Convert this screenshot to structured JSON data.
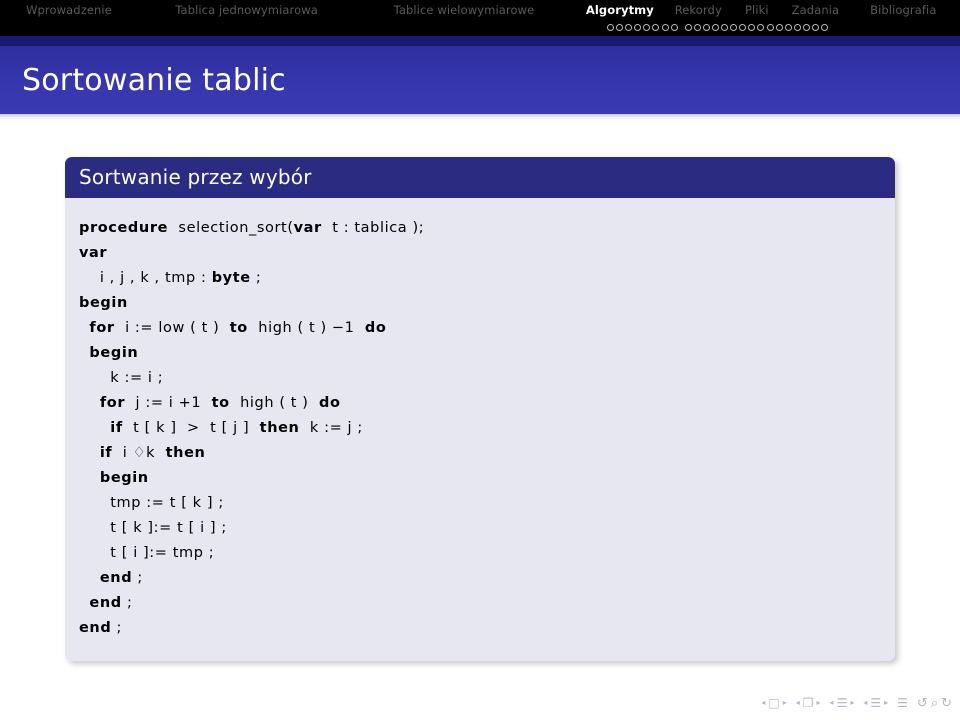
{
  "navbar": {
    "sections": [
      {
        "label": "Wprowadzenie",
        "active": false
      },
      {
        "label": "Tablica jednowymiarowa",
        "active": false
      },
      {
        "label": "Tablice wielowymiarowe",
        "active": false
      },
      {
        "label": "Algorytmy",
        "active": true
      },
      {
        "label": "Rekordy",
        "active": false
      },
      {
        "label": "Pliki",
        "active": false
      },
      {
        "label": "Zadania",
        "active": false
      },
      {
        "label": "Bibliografia",
        "active": false
      }
    ],
    "slide_dots": {
      "group_1_count": 8,
      "group_2_count": 16,
      "filled": 0
    }
  },
  "header": {
    "title": "Sortowanie tablic"
  },
  "block": {
    "title": "Sortwanie przez wybór",
    "code_lines": [
      [
        {
          "t": "procedure",
          "kw": true
        },
        {
          "t": "  selection_sort(",
          "kw": false
        },
        {
          "t": "var",
          "kw": true
        },
        {
          "t": "  t : tablica );",
          "kw": false
        }
      ],
      [
        {
          "t": "var",
          "kw": true
        }
      ],
      [
        {
          "t": "    i , j , k , tmp : ",
          "kw": false
        },
        {
          "t": "byte",
          "kw": true
        },
        {
          "t": " ;",
          "kw": false
        }
      ],
      [
        {
          "t": "begin",
          "kw": true
        }
      ],
      [
        {
          "t": "  ",
          "kw": false
        },
        {
          "t": "for",
          "kw": true
        },
        {
          "t": "  i := low ( t )  ",
          "kw": false
        },
        {
          "t": "to",
          "kw": true
        },
        {
          "t": "  high ( t ) −1  ",
          "kw": false
        },
        {
          "t": "do",
          "kw": true
        }
      ],
      [
        {
          "t": "  ",
          "kw": false
        },
        {
          "t": "begin",
          "kw": true
        }
      ],
      [
        {
          "t": "      k := i ;",
          "kw": false
        }
      ],
      [
        {
          "t": "    ",
          "kw": false
        },
        {
          "t": "for",
          "kw": true
        },
        {
          "t": "  j := i +1  ",
          "kw": false
        },
        {
          "t": "to",
          "kw": true
        },
        {
          "t": "  high ( t )  ",
          "kw": false
        },
        {
          "t": "do",
          "kw": true
        }
      ],
      [
        {
          "t": "      ",
          "kw": false
        },
        {
          "t": "if",
          "kw": true
        },
        {
          "t": "  t [ k ]  >  t [ j ]  ",
          "kw": false
        },
        {
          "t": "then",
          "kw": true
        },
        {
          "t": "  k := j ;",
          "kw": false
        }
      ],
      [
        {
          "t": "    ",
          "kw": false
        },
        {
          "t": "if",
          "kw": true
        },
        {
          "t": "  i ♢k  ",
          "kw": false
        },
        {
          "t": "then",
          "kw": true
        }
      ],
      [
        {
          "t": "    ",
          "kw": false
        },
        {
          "t": "begin",
          "kw": true
        }
      ],
      [
        {
          "t": "      tmp := t [ k ] ;",
          "kw": false
        }
      ],
      [
        {
          "t": "      t [ k ]:= t [ i ] ;",
          "kw": false
        }
      ],
      [
        {
          "t": "      t [ i ]:= tmp ;",
          "kw": false
        }
      ],
      [
        {
          "t": "    ",
          "kw": false
        },
        {
          "t": "end",
          "kw": true
        },
        {
          "t": " ;",
          "kw": false
        }
      ],
      [
        {
          "t": "  ",
          "kw": false
        },
        {
          "t": "end",
          "kw": true
        },
        {
          "t": " ;",
          "kw": false
        }
      ],
      [
        {
          "t": "end",
          "kw": true
        },
        {
          "t": " ;",
          "kw": false
        }
      ]
    ]
  },
  "nav_symbols": {
    "groups": [
      {
        "prev": "◂",
        "icon": "□",
        "next": "▸",
        "icon_name": "slide-icon"
      },
      {
        "prev": "◂",
        "icon": "❐",
        "next": "▸",
        "icon_name": "frame-icon"
      },
      {
        "prev": "◂",
        "icon": "☰",
        "next": "▸",
        "icon_name": "subsection-icon"
      },
      {
        "prev": "◂",
        "icon": "☰",
        "next": "▸",
        "icon_name": "section-icon"
      }
    ],
    "doc_icon": "☰",
    "tools": [
      {
        "glyph": "↺",
        "name": "back-icon"
      },
      {
        "glyph": "⌕",
        "name": "search-icon"
      },
      {
        "glyph": "↻",
        "name": "forward-icon"
      }
    ]
  },
  "colors": {
    "navbar_bg": "#000000",
    "navbar_active_text": "#ffffff",
    "navbar_inactive_text": "#5a5a5a",
    "title_bar_blue": "#3636ad",
    "title_strip_navy": "#191970",
    "block_title_bg": "#2b2b82",
    "block_body_bg": "#e6e7f1",
    "code_text": "#000000",
    "nav_symbol": "#b5b5c8"
  }
}
